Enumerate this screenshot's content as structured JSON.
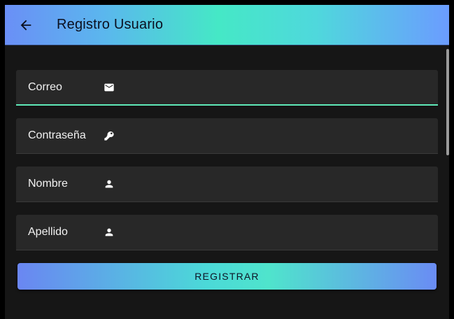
{
  "app_bar": {
    "title": "Registro Usuario",
    "back_icon": "arrow-left-icon"
  },
  "form": {
    "fields": [
      {
        "label": "Correo",
        "icon": "mail-icon",
        "value": "",
        "focused": true
      },
      {
        "label": "Contraseña",
        "icon": "key-icon",
        "value": "",
        "focused": false
      },
      {
        "label": "Nombre",
        "icon": "person-icon",
        "value": "",
        "focused": false
      },
      {
        "label": "Apellido",
        "icon": "person-icon",
        "value": "",
        "focused": false
      }
    ],
    "submit_label": "REGISTRAR"
  },
  "colors": {
    "background": "#161616",
    "field_background": "#282828",
    "focus_underline": "#5fe8b8",
    "gradient_start": "#6a8ff6",
    "gradient_mid": "#45e8c6",
    "gradient_end": "#6b9cff"
  }
}
